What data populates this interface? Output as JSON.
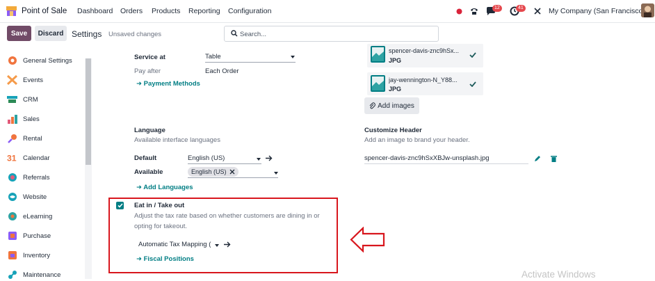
{
  "topbar": {
    "app_name": "Point of Sale",
    "menu": [
      "Dashboard",
      "Orders",
      "Products",
      "Reporting",
      "Configuration"
    ],
    "messages_count": "12",
    "activities_count": "41",
    "company": "My Company (San Francisco)"
  },
  "control": {
    "save_label": "Save",
    "discard_label": "Discard",
    "title": "Settings",
    "unsaved": "Unsaved changes",
    "search_placeholder": "Search..."
  },
  "sidebar": {
    "items": [
      {
        "label": "General Settings",
        "icon": "gear-icon"
      },
      {
        "label": "Events",
        "icon": "events-icon"
      },
      {
        "label": "CRM",
        "icon": "crm-icon"
      },
      {
        "label": "Sales",
        "icon": "sales-icon"
      },
      {
        "label": "Rental",
        "icon": "rental-icon"
      },
      {
        "label": "Calendar",
        "icon": "calendar-icon"
      },
      {
        "label": "Referrals",
        "icon": "referrals-icon"
      },
      {
        "label": "Website",
        "icon": "website-icon"
      },
      {
        "label": "eLearning",
        "icon": "elearning-icon"
      },
      {
        "label": "Purchase",
        "icon": "purchase-icon"
      },
      {
        "label": "Inventory",
        "icon": "inventory-icon"
      },
      {
        "label": "Maintenance",
        "icon": "maintenance-icon"
      }
    ]
  },
  "service": {
    "label": "Service at",
    "value": "Table",
    "pay_after_label": "Pay after",
    "pay_after_value": "Each Order",
    "link": "Payment Methods"
  },
  "images": {
    "items": [
      {
        "name": "spencer-davis-znc9hSx...",
        "ext": "JPG"
      },
      {
        "name": "jay-wennington-N_Y88...",
        "ext": "JPG"
      }
    ],
    "add_label": "Add images"
  },
  "language": {
    "title": "Language",
    "desc": "Available interface languages",
    "default_label": "Default",
    "default_value": "English (US)",
    "available_label": "Available",
    "available_tag": "English (US)",
    "link": "Add Languages"
  },
  "header": {
    "title": "Customize Header",
    "desc": "Add an image to brand your header.",
    "file": "spencer-davis-znc9hSxXBJw-unsplash.jpg"
  },
  "eat_in": {
    "title": "Eat in / Take out",
    "desc_line1": "Adjust the tax rate based on whether customers are dining in or",
    "desc_line2": "opting for takeout.",
    "value": "Automatic Tax Mapping (",
    "link": "Fiscal Positions",
    "checked": true
  },
  "watermark": "Activate Windows",
  "colors": {
    "brand": "#714b67",
    "teal": "#017e84",
    "highlight": "#d8161d"
  }
}
